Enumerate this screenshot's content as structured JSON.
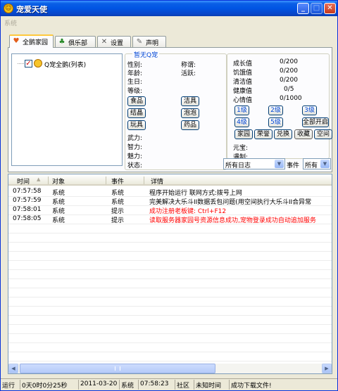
{
  "window": {
    "title": "宠爱天使"
  },
  "menu": {
    "system": "系统"
  },
  "tabs": [
    {
      "label": "全鹅家园",
      "icon": "pet-icon"
    },
    {
      "label": "俱乐部",
      "icon": "club-icon"
    },
    {
      "label": "设置",
      "icon": "tools-icon"
    },
    {
      "label": "声明",
      "icon": "statement-icon"
    }
  ],
  "tree": {
    "item": "Q宠全鹅(列表)",
    "checked": true
  },
  "pet": {
    "legend": "暂无Q宠",
    "gender": "性别:",
    "title": "称谓:",
    "age": "年龄:",
    "active": "活跃:",
    "birthday": "生日:",
    "level": "等级:",
    "force": "武力:",
    "intellect": "智力:",
    "charm": "魅力:",
    "state": "状态:",
    "buttons": {
      "food": "食品",
      "cleaning": "洁具",
      "crystal": "结晶",
      "bubble": "泡泡",
      "toy": "玩具",
      "medicine": "药品"
    }
  },
  "stats": {
    "growth": {
      "label": "成长值",
      "value": "0/200"
    },
    "hunger": {
      "label": "饥饿值",
      "value": "0/200"
    },
    "clean": {
      "label": "清洁值",
      "value": "0/200"
    },
    "health": {
      "label": "健康值",
      "value": "0/5"
    },
    "mood": {
      "label": "心情值",
      "value": "0/1000"
    },
    "level_buttons": [
      "1级",
      "2级",
      "3级",
      "4级",
      "5级"
    ],
    "open_all": "全部开启",
    "action_buttons": [
      "家园",
      "荣誉",
      "兑换",
      "收藏",
      "空间"
    ],
    "yuanbao": "元宝:",
    "control": "遇制:"
  },
  "filters": {
    "log_select": "所有日志",
    "event_label": "事件",
    "event_select": "所有"
  },
  "log": {
    "headers": [
      "时间",
      "对象",
      "事件",
      "详情"
    ],
    "rows": [
      {
        "time": "07:57:58",
        "object": "系统",
        "event": "系统",
        "detail": "程序开始运行  联网方式:拨号上网",
        "color": "#000000"
      },
      {
        "time": "07:57:59",
        "object": "系统",
        "event": "系统",
        "detail": "完美解决大乐斗II数据丢包问题(用空间执行大乐斗II合异常",
        "color": "#000000"
      },
      {
        "time": "07:58:01",
        "object": "系统",
        "event": "提示",
        "detail": "成功注册老板键: Ctrl+F12",
        "color": "#ff0000"
      },
      {
        "time": "07:58:05",
        "object": "系统",
        "event": "提示",
        "detail": "读取服务器家园号资源信息成功,宠物登录成功自动追加服务",
        "color": "#ff0000"
      }
    ]
  },
  "status": {
    "running": "运行",
    "uptime": "0天0时0分25秒",
    "date": "2011-03-20",
    "system": "系统",
    "time": "07:58:23",
    "community": "社区",
    "unknown": "未知时间",
    "message": "成功下载文件!"
  }
}
